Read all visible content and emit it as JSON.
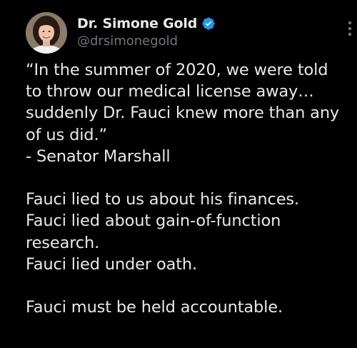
{
  "author": {
    "display_name": "Dr. Simone Gold",
    "handle": "@drsimonegold",
    "verified": true,
    "avatar_icon": "profile-photo"
  },
  "tweet": {
    "lines": [
      "“In the summer of 2020, we were told",
      "to throw our medical license away…",
      "suddenly Dr. Fauci knew more than any",
      "of us did.”",
      "- Senator Marshall",
      "",
      "Fauci lied to us about his finances.",
      "Fauci lied about gain-of-function",
      "research.",
      "Fauci lied under oath.",
      "",
      "Fauci must be held accountable."
    ]
  },
  "colors": {
    "background": "#000000",
    "text": "#e7e9ea",
    "secondary_text": "#71767b",
    "verified_badge": "#1d9bf0"
  },
  "icons": {
    "verified": "verified-badge-icon",
    "more": "more-options-icon"
  }
}
